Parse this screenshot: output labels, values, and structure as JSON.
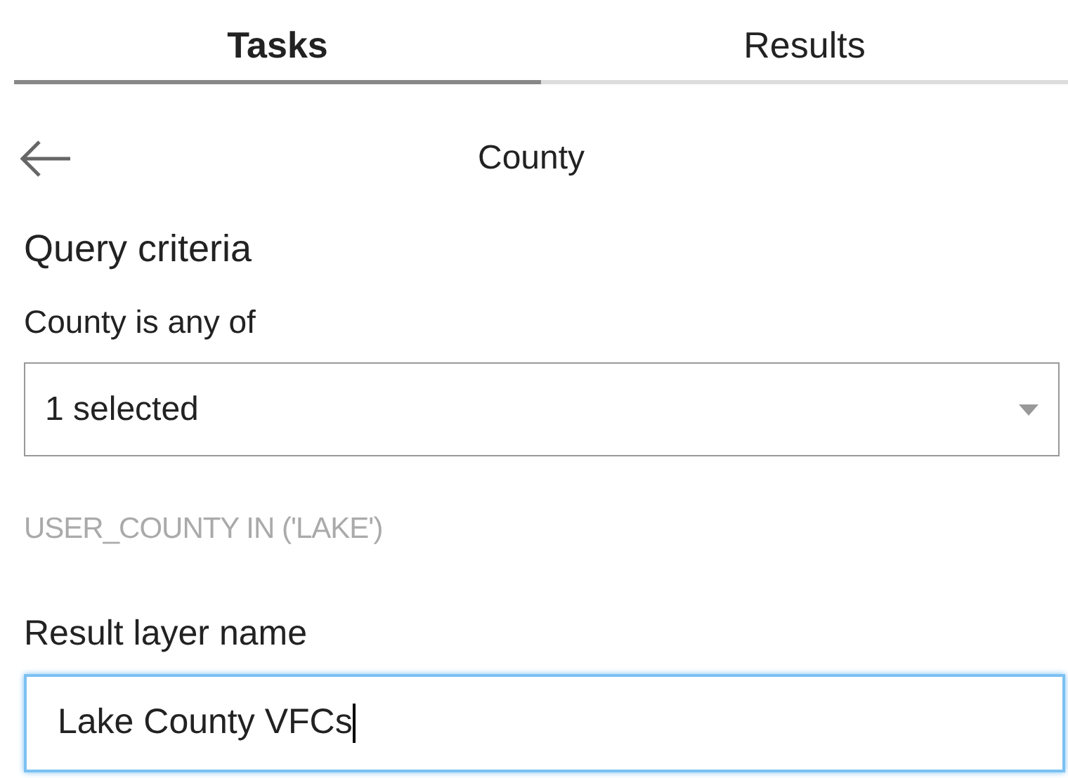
{
  "tabs": [
    {
      "label": "Tasks",
      "selected": true
    },
    {
      "label": "Results",
      "selected": false
    }
  ],
  "header": {
    "title": "County"
  },
  "query": {
    "heading": "Query criteria",
    "label": "County is any of",
    "dropdown_value": "1 selected",
    "expression": "USER_COUNTY IN ('LAKE')"
  },
  "result_layer": {
    "label": "Result layer name",
    "value": "Lake County VFCs",
    "focused": true
  }
}
